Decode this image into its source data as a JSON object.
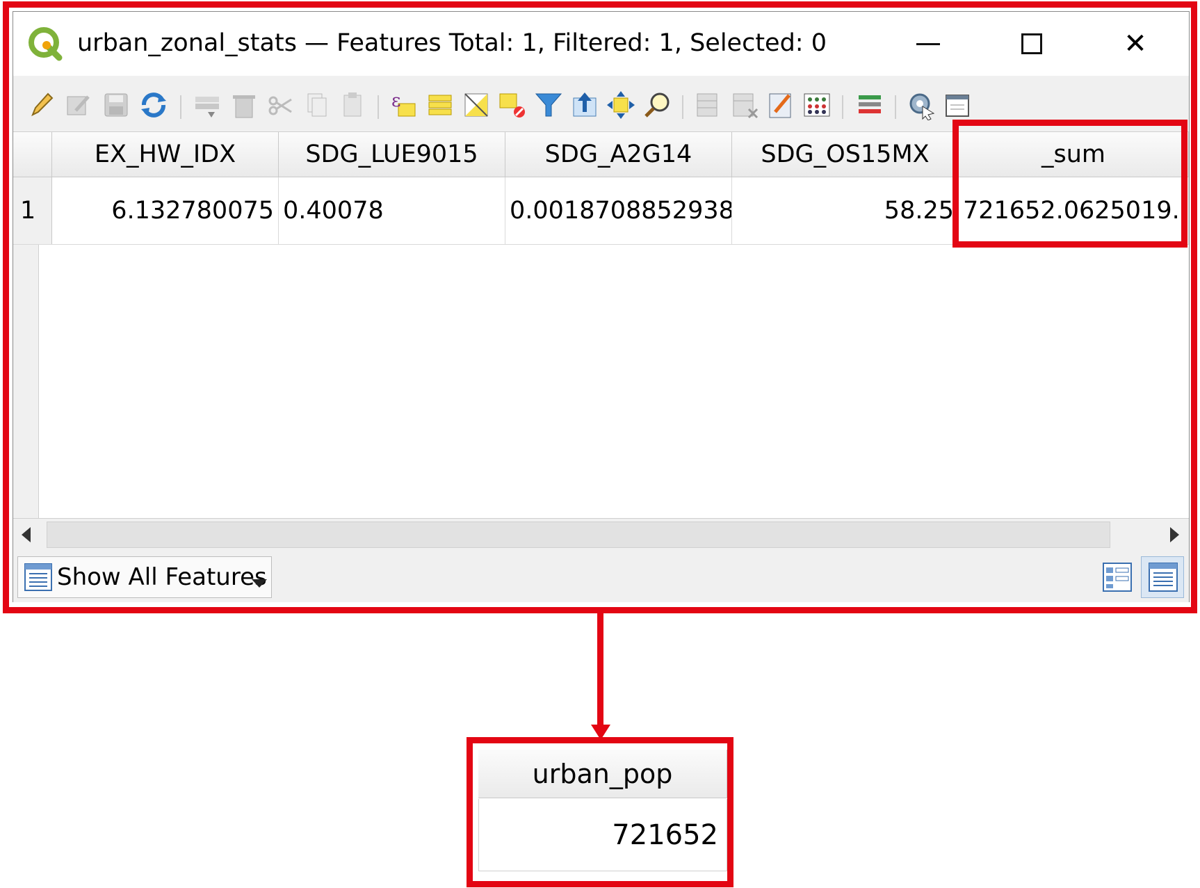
{
  "window": {
    "title": "urban_zonal_stats — Features Total: 1, Filtered: 1, Selected: 0",
    "close_glyph": "✕"
  },
  "toolbar": {
    "icons": [
      "pencil-icon",
      "multi-edit-icon",
      "save-edits-icon",
      "reload-icon",
      "add-feature-icon",
      "delete-feature-icon",
      "cut-icon",
      "copy-icon",
      "paste-icon",
      "select-by-expression-icon",
      "select-all-icon",
      "invert-selection-icon",
      "deselect-all-icon",
      "filter-select-icon",
      "move-selection-to-top-icon",
      "pan-to-selected-icon",
      "zoom-to-selected-icon",
      "new-field-icon",
      "delete-field-icon",
      "field-calculator-icon",
      "conditional-formatting-icon",
      "organize-columns-icon",
      "actions-icon",
      "dock-table-icon"
    ]
  },
  "table": {
    "columns": [
      "EX_HW_IDX",
      "SDG_LUE9015",
      "SDG_A2G14",
      "SDG_OS15MX",
      "_sum"
    ],
    "row_number": "1",
    "row": [
      "6.132780075",
      "0.40078",
      "0.0018708852938",
      "58.25",
      "721652.0625019.."
    ]
  },
  "bottom_bar": {
    "show_all_label": "Show All Features"
  },
  "zoom": {
    "header": "urban_pop",
    "value": "721652"
  },
  "colors": {
    "highlight": "#e30613"
  }
}
